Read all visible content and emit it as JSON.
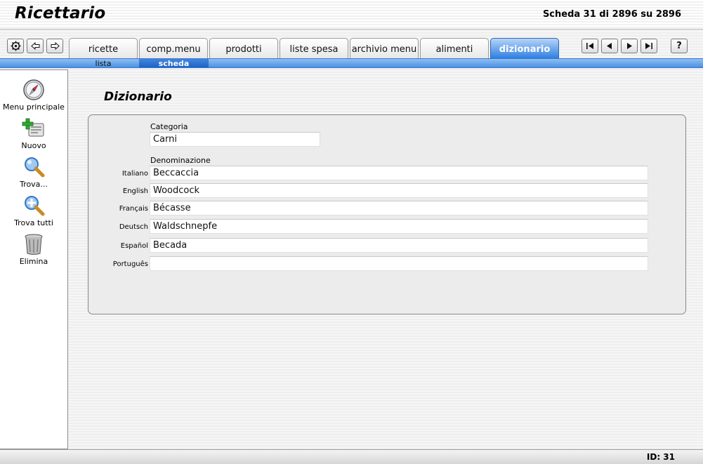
{
  "header": {
    "title": "Ricettario",
    "record_status": "Scheda 31 di 2896 su 2896"
  },
  "toolbar": {
    "settings_icon": "gear-icon",
    "back_icon": "arrow-left-icon",
    "forward_icon": "arrow-right-icon",
    "help_label": "?"
  },
  "tabs": [
    {
      "label": "ricette"
    },
    {
      "label": "comp.menu"
    },
    {
      "label": "prodotti"
    },
    {
      "label": "liste spesa"
    },
    {
      "label": "archivio menu"
    },
    {
      "label": "alimenti"
    },
    {
      "label": "dizionario",
      "active": true
    }
  ],
  "subtabs": [
    {
      "label": "lista"
    },
    {
      "label": "scheda",
      "active": true
    }
  ],
  "sidebar": {
    "items": [
      {
        "label": "Menu principale",
        "icon": "compass-icon"
      },
      {
        "label": "Nuovo",
        "icon": "add-record-icon"
      },
      {
        "label": "Trova...",
        "icon": "magnifier-icon"
      },
      {
        "label": "Trova tutti",
        "icon": "magnifier-plus-icon"
      },
      {
        "label": "Elimina",
        "icon": "trash-icon"
      }
    ]
  },
  "main": {
    "title": "Dizionario",
    "category_label": "Categoria",
    "category_value": "Carni",
    "denomination_label": "Denominazione",
    "languages": [
      {
        "label": "Italiano",
        "value": "Beccaccia"
      },
      {
        "label": "English",
        "value": "Woodcock"
      },
      {
        "label": "Français",
        "value": "Bécasse"
      },
      {
        "label": "Deutsch",
        "value": "Waldschnepfe"
      },
      {
        "label": "Español",
        "value": "Becada"
      },
      {
        "label": "Português",
        "value": ""
      }
    ]
  },
  "footer": {
    "id_text": "ID: 31"
  },
  "colors": {
    "accent_blue": "#2f7fe2",
    "panel_bg": "#ececec"
  }
}
